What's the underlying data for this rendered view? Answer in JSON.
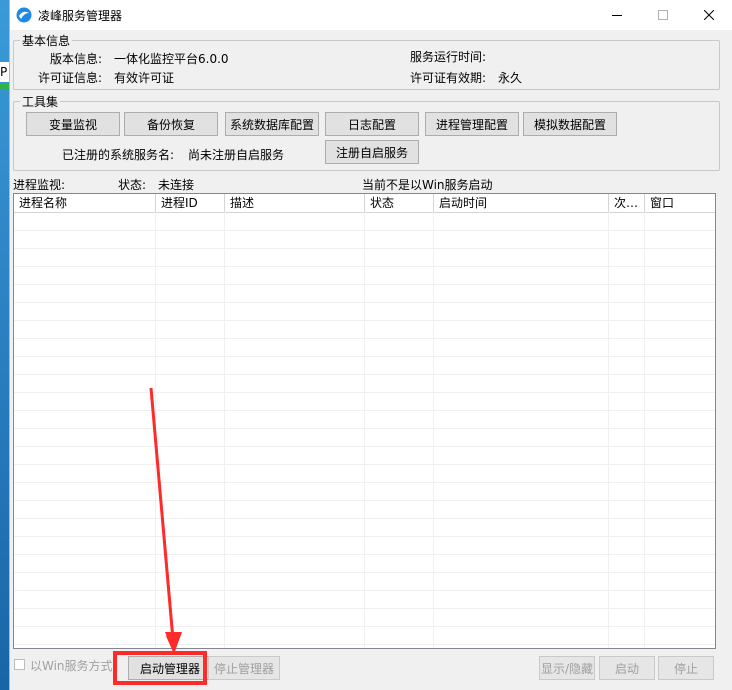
{
  "desktop": {
    "edge_letter": "P"
  },
  "window": {
    "title": "凌峰服务管理器",
    "controls": {
      "minimize": "minimize",
      "maximize": "maximize",
      "close": "close"
    }
  },
  "basic_info": {
    "legend": "基本信息",
    "version_label": "版本信息:",
    "version_value": "一体化监控平台6.0.0",
    "runtime_label": "服务运行时间:",
    "runtime_value": "",
    "license_label": "许可证信息:",
    "license_value": "有效许可证",
    "license_expiry_label": "许可证有效期:",
    "license_expiry_value": "永久"
  },
  "toolset": {
    "legend": "工具集",
    "buttons": [
      "变量监视",
      "备份恢复",
      "系统数据库配置",
      "日志配置",
      "进程管理配置",
      "模拟数据配置"
    ],
    "registered_label": "已注册的系统服务名:",
    "registered_value": "尚未注册自启服务",
    "register_button": "注册自启服务"
  },
  "process_monitor": {
    "label": "进程监视:",
    "status_label": "状态:",
    "status_value": "未连接",
    "mode_notice": "当前不是以Win服务启动",
    "columns": [
      "进程名称",
      "进程ID",
      "描述",
      "状态",
      "启动时间",
      "次…",
      "窗口"
    ],
    "rows": []
  },
  "footer": {
    "win_service_checkbox": "以Win服务方式",
    "start_manager": "启动管理器",
    "stop_manager": "停止管理器",
    "show_hide": "显示/隐藏",
    "start": "启动",
    "stop": "停止"
  },
  "colors": {
    "highlight": "#ff2a2a",
    "annotation_arrow": "#ff2a2a",
    "app_icon": "#1e88e5"
  }
}
